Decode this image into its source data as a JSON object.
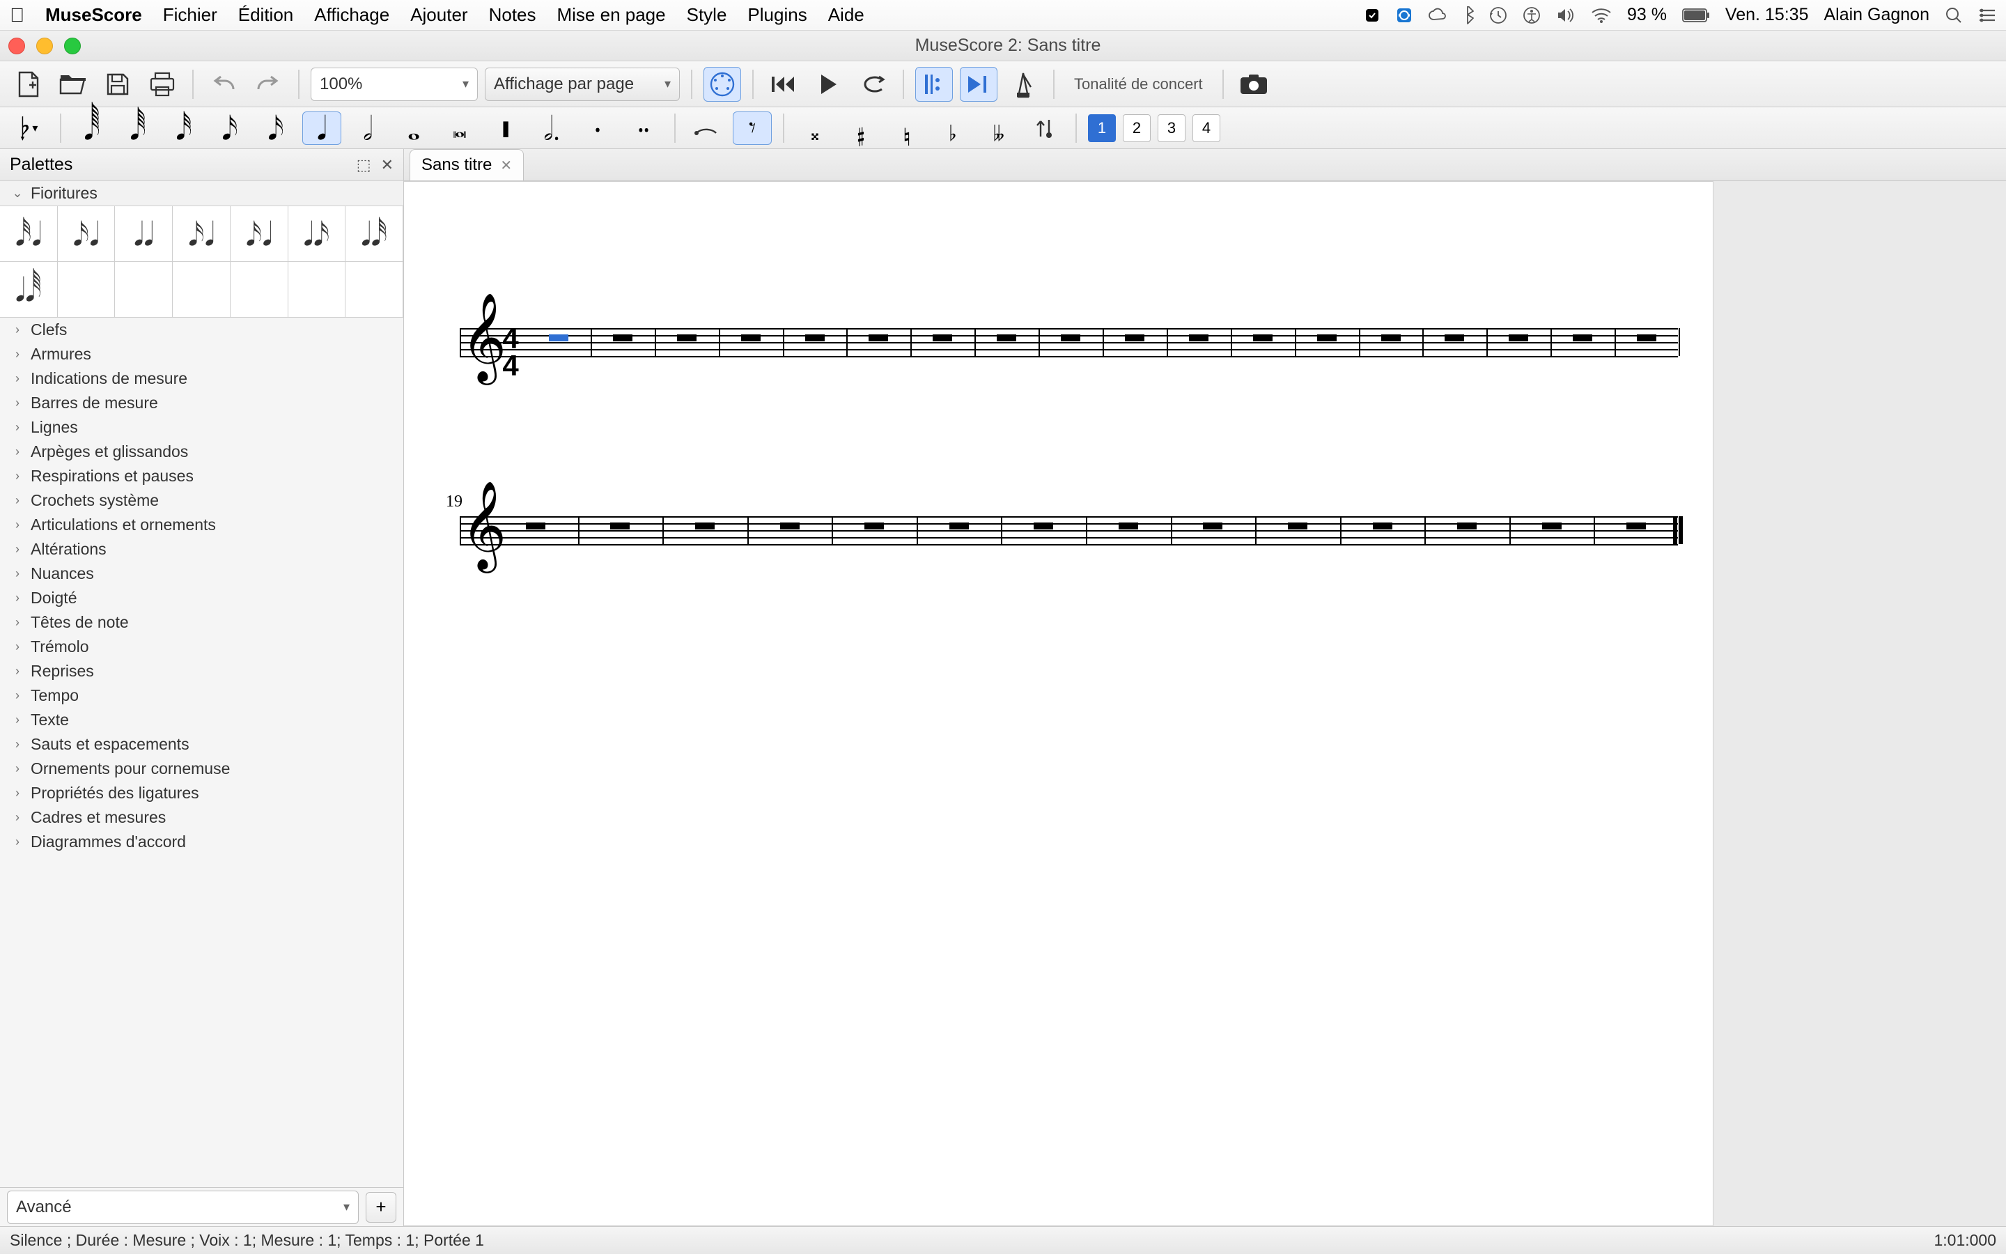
{
  "menubar": {
    "app_name": "MuseScore",
    "items": [
      "Fichier",
      "Édition",
      "Affichage",
      "Ajouter",
      "Notes",
      "Mise en page",
      "Style",
      "Plugins",
      "Aide"
    ],
    "right": {
      "battery_pct": "93 %",
      "day_time": "Ven. 15:35",
      "user": "Alain Gagnon"
    }
  },
  "window": {
    "title": "MuseScore 2: Sans titre"
  },
  "toolbar": {
    "zoom": "100%",
    "view_mode": "Affichage par page",
    "concert_pitch_label": "Tonalité de concert"
  },
  "notebar": {
    "voices": [
      "1",
      "2",
      "3",
      "4"
    ],
    "active_voice": 0
  },
  "palettes": {
    "header": "Palettes",
    "expanded": "Fioritures",
    "categories": [
      "Clefs",
      "Armures",
      "Indications de mesure",
      "Barres de mesure",
      "Lignes",
      "Arpèges et glissandos",
      "Respirations et pauses",
      "Crochets système",
      "Articulations et ornements",
      "Altérations",
      "Nuances",
      "Doigté",
      "Têtes de note",
      "Trémolo",
      "Reprises",
      "Tempo",
      "Texte",
      "Sauts et espacements",
      "Ornements pour cornemuse",
      "Propriétés des ligatures",
      "Cadres et mesures",
      "Diagrammes d'accord"
    ],
    "workspace_selector": "Avancé"
  },
  "tabs": {
    "items": [
      {
        "label": "Sans titre"
      }
    ]
  },
  "score": {
    "system2_start_measure": "19",
    "time_sig_top": "4",
    "time_sig_bottom": "4"
  },
  "statusbar": {
    "left": "Silence ; Durée : Mesure ; Voix : 1;  Mesure : 1; Temps : 1; Portée 1",
    "right": "1:01:000"
  }
}
